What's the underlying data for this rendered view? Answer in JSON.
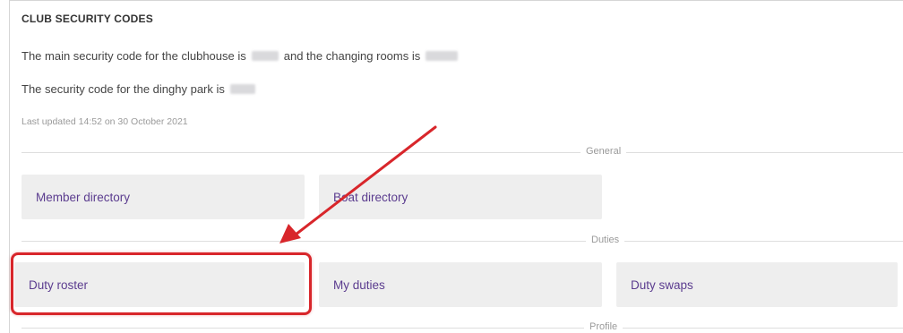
{
  "security": {
    "heading": "CLUB SECURITY CODES",
    "line1_part1": "The main security code for the clubhouse is",
    "line1_part2": "and the changing rooms is",
    "line2": "The security code for the dinghy park is",
    "updated": "Last updated 14:52 on 30 October 2021"
  },
  "sections": {
    "general": "General",
    "duties": "Duties",
    "profile": "Profile"
  },
  "tiles": {
    "member_directory": "Member directory",
    "boat_directory": "Boat directory",
    "duty_roster": "Duty roster",
    "my_duties": "My duties",
    "duty_swaps": "Duty swaps"
  },
  "colors": {
    "tile_text": "#5b3c8f",
    "annotation": "#d8262b"
  }
}
